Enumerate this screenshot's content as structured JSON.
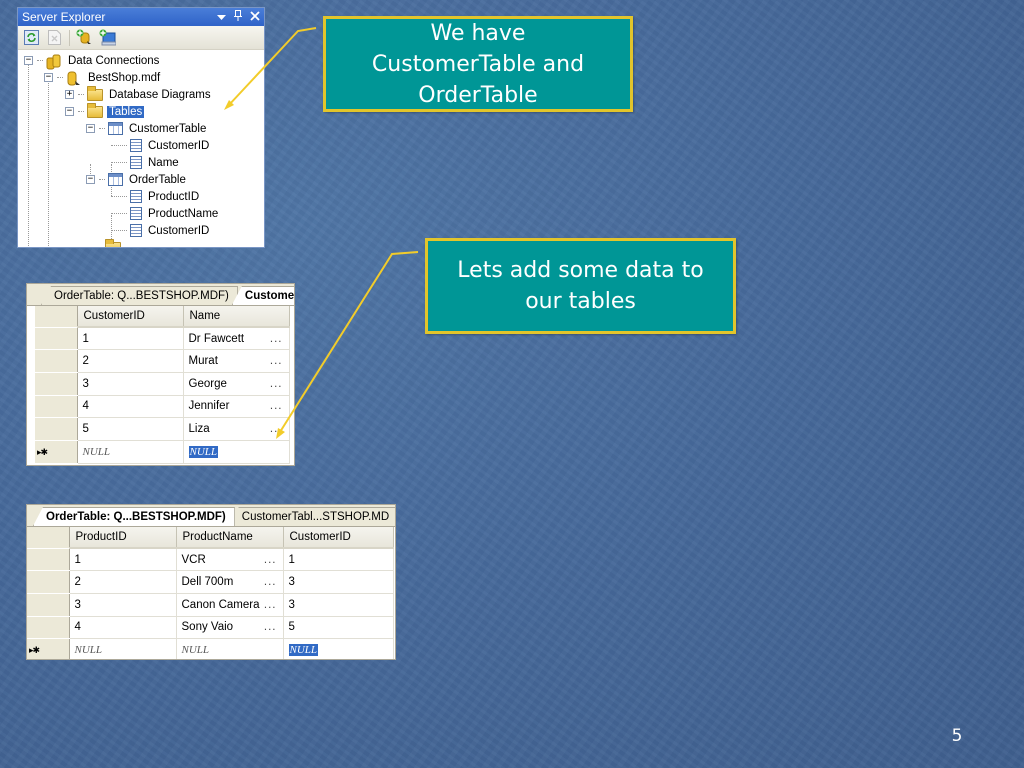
{
  "slide": {
    "page_number": "5",
    "background_color": "#46699a",
    "callout_color": "#009696",
    "callout_border_color": "#e2c52b"
  },
  "server_explorer": {
    "title": "Server Explorer",
    "controls": {
      "dropdown_icon": "▾",
      "pin_icon": "📌",
      "close_icon": "✕"
    },
    "toolbar": [
      {
        "name": "refresh-icon"
      },
      {
        "name": "stop-icon"
      },
      {
        "name": "connect-to-database-icon"
      },
      {
        "name": "connect-to-server-icon"
      }
    ],
    "tree": {
      "data_connections": {
        "label": "Data Connections",
        "expander": "−"
      },
      "db": {
        "label": "BestShop.mdf",
        "expander": "−"
      },
      "database_diagrams": {
        "label": "Database Diagrams",
        "expander": "+"
      },
      "tables": {
        "label": "Tables",
        "expander": "−",
        "selected": true
      },
      "customer_table": {
        "label": "CustomerTable",
        "expander": "−",
        "columns": [
          "CustomerID",
          "Name"
        ]
      },
      "order_table": {
        "label": "OrderTable",
        "expander": "−",
        "columns": [
          "ProductID",
          "ProductName",
          "CustomerID"
        ]
      }
    }
  },
  "customer_grid": {
    "tabs": [
      {
        "label": "OrderTable: Q...BESTSHOP.MDF)",
        "active": false
      },
      {
        "label": "Custome",
        "active": true
      }
    ],
    "columns": [
      "CustomerID",
      "Name"
    ],
    "rows": [
      {
        "CustomerID": "1",
        "Name": "Dr Fawcett"
      },
      {
        "CustomerID": "2",
        "Name": "Murat"
      },
      {
        "CustomerID": "3",
        "Name": "George"
      },
      {
        "CustomerID": "4",
        "Name": "Jennifer"
      },
      {
        "CustomerID": "5",
        "Name": "Liza"
      }
    ],
    "ellipsis": "...",
    "new_row": {
      "marker": "▸✱",
      "CustomerID": "NULL",
      "Name": "NULL"
    }
  },
  "order_grid": {
    "tabs": [
      {
        "label": "OrderTable: Q...BESTSHOP.MDF)",
        "active": true
      },
      {
        "label": "CustomerTabl...STSHOP.MD",
        "active": false
      }
    ],
    "columns": [
      "ProductID",
      "ProductName",
      "CustomerID"
    ],
    "rows": [
      {
        "ProductID": "1",
        "ProductName": "VCR",
        "CustomerID": "1"
      },
      {
        "ProductID": "2",
        "ProductName": "Dell 700m",
        "CustomerID": "3"
      },
      {
        "ProductID": "3",
        "ProductName": "Canon Camera",
        "CustomerID": "3"
      },
      {
        "ProductID": "4",
        "ProductName": "Sony Vaio",
        "CustomerID": "5"
      }
    ],
    "ellipsis": "...",
    "new_row": {
      "marker": "▸✱",
      "ProductID": "NULL",
      "ProductName": "NULL",
      "CustomerID": "NULL"
    }
  },
  "callouts": {
    "tables_note": {
      "lines": [
        "We have",
        "CustomerTable and",
        "OrderTable"
      ]
    },
    "data_note": {
      "lines": [
        "Lets add some data to",
        "our tables"
      ]
    }
  }
}
